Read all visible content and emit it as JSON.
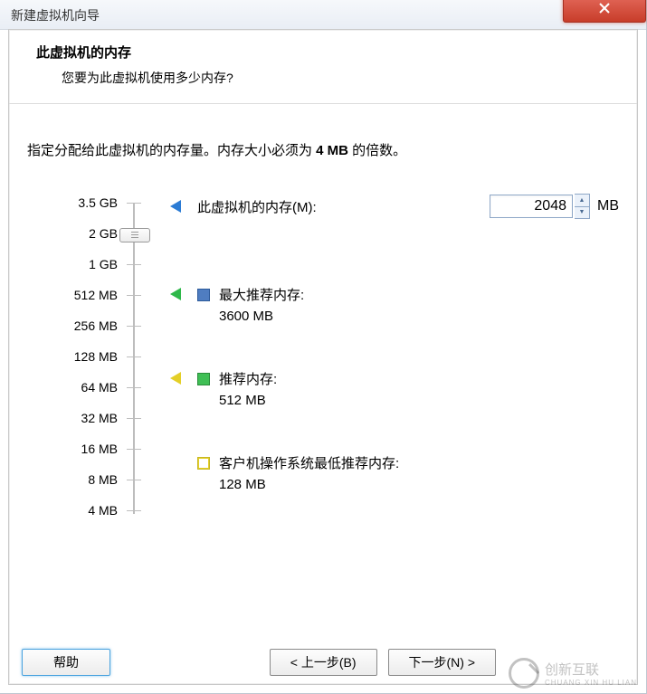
{
  "window": {
    "title": "新建虚拟机向导"
  },
  "header": {
    "title": "此虚拟机的内存",
    "subtitle": "您要为此虚拟机使用多少内存?"
  },
  "instruction": {
    "prefix": "指定分配给此虚拟机的内存量。内存大小必须为 ",
    "bold": "4 MB",
    "suffix": " 的倍数。"
  },
  "memory": {
    "label": "此虚拟机的内存(M):",
    "value": "2048",
    "unit": "MB"
  },
  "scale": [
    "3.5 GB",
    "2 GB",
    "1 GB",
    "512 MB",
    "256 MB",
    "128 MB",
    "64 MB",
    "32 MB",
    "16 MB",
    "8 MB",
    "4 MB"
  ],
  "legend": {
    "max": {
      "label": "最大推荐内存:",
      "value": "3600 MB"
    },
    "rec": {
      "label": "推荐内存:",
      "value": "512 MB"
    },
    "min": {
      "label": "客户机操作系统最低推荐内存:",
      "value": "128 MB"
    }
  },
  "footer": {
    "help": "帮助",
    "back": "< 上一步(B)",
    "next": "下一步(N) >"
  },
  "watermark": {
    "text": "创新互联",
    "sub": "CHUANG XIN HU LIAN"
  }
}
